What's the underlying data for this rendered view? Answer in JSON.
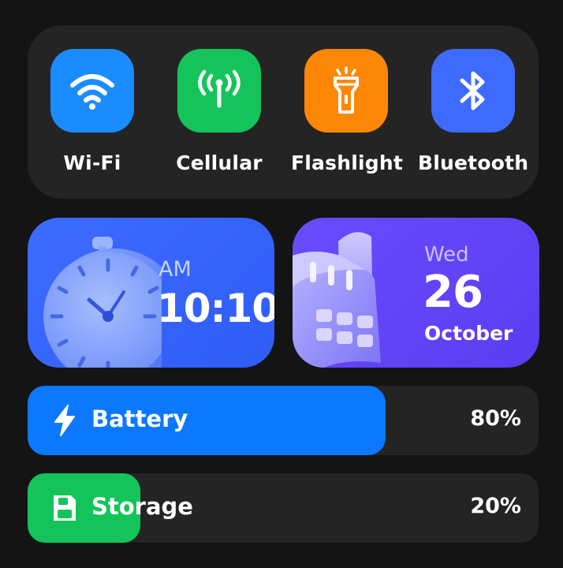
{
  "colors": {
    "background": "#141414",
    "panel": "#242424",
    "wifi": "#1a8cff",
    "cellular": "#14c45a",
    "flashlight": "#ff8708",
    "bluetooth": "#3d6bff",
    "clock_widget": "#3e6bff",
    "calendar_widget": "#6a4cff",
    "battery_fill": "#0b78ff",
    "storage_fill": "#14c45a"
  },
  "toggles": [
    {
      "label": "Wi-Fi",
      "icon": "wifi-icon"
    },
    {
      "label": "Cellular",
      "icon": "cellular-antenna-icon"
    },
    {
      "label": "Flashlight",
      "icon": "flashlight-icon"
    },
    {
      "label": "Bluetooth",
      "icon": "bluetooth-icon"
    }
  ],
  "clock": {
    "meridiem": "AM",
    "time": "10:10",
    "icon": "clock-illustration"
  },
  "calendar": {
    "weekday": "Wed",
    "day": "26",
    "month": "October",
    "icon": "calendar-illustration"
  },
  "battery": {
    "label": "Battery",
    "value": "80%",
    "fill_fraction": 0.7,
    "icon": "lightning-bolt-icon"
  },
  "storage": {
    "label": "Storage",
    "value": "20%",
    "fill_fraction": 0.22,
    "icon": "save-disk-icon"
  }
}
